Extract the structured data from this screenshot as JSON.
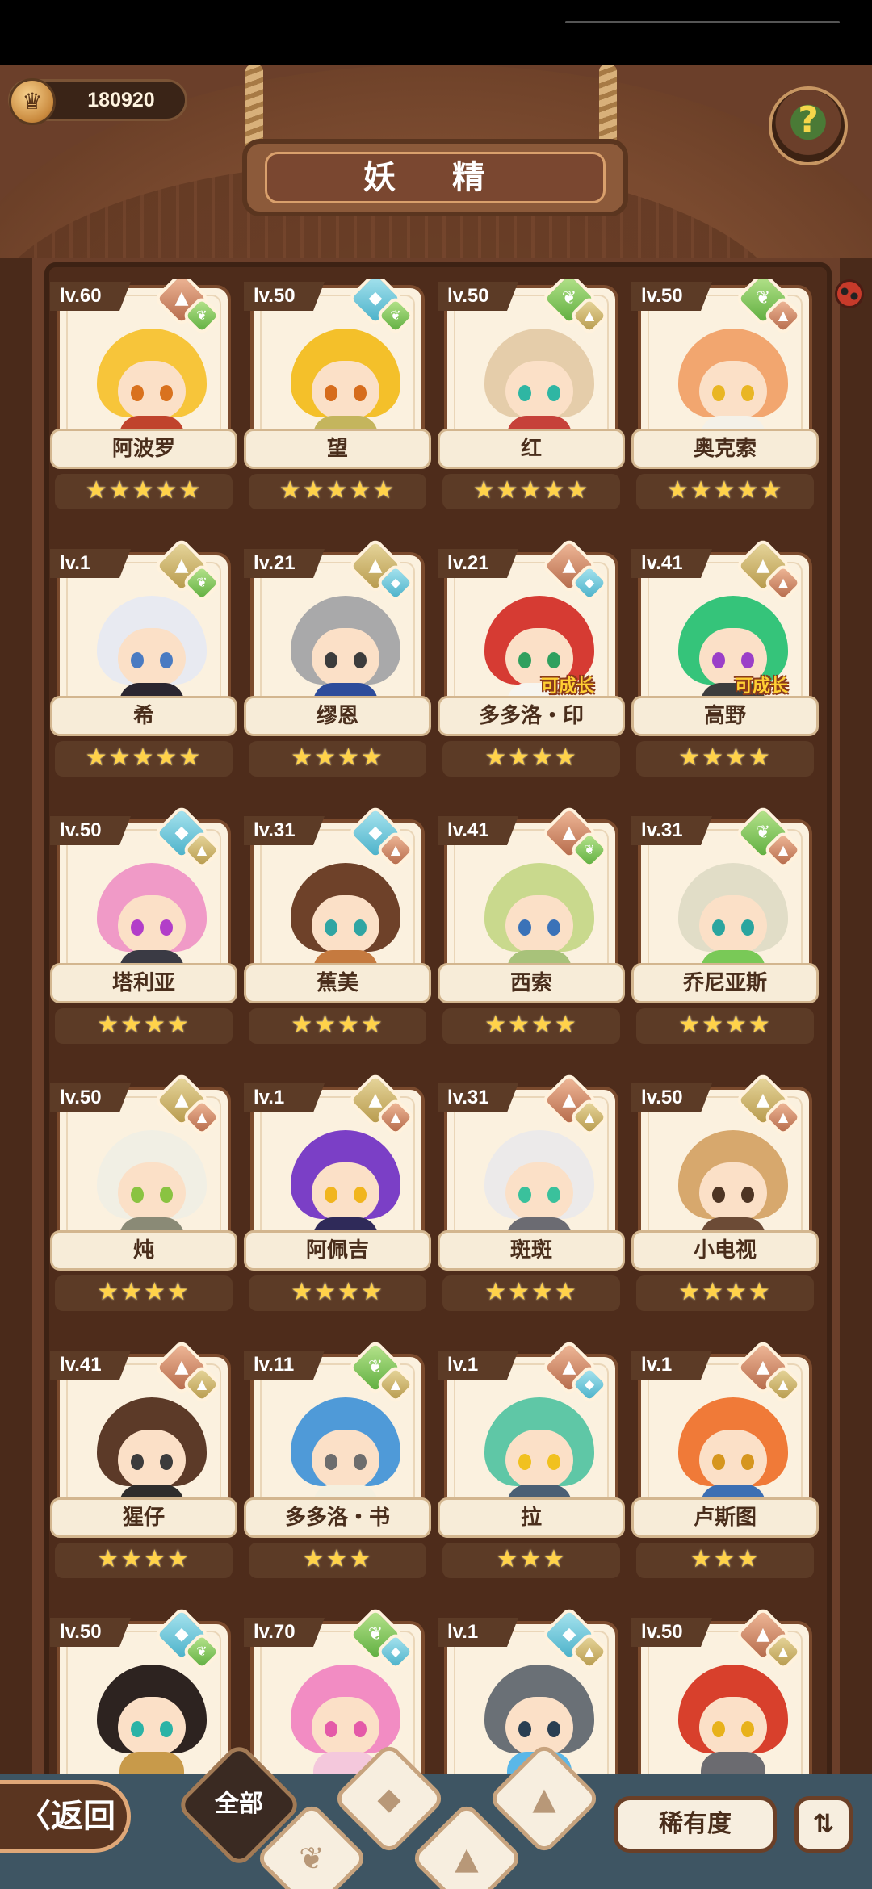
{
  "header": {
    "coin_value": "180920",
    "title": "妖 精",
    "help_icon": "question-sprout-icon"
  },
  "colors": {
    "fire": "#b56a4a",
    "water": "#4bb1c9",
    "leaf": "#5fae3f",
    "earth": "#b79a4c",
    "star": "#ffd24a"
  },
  "grid": {
    "cards": [
      {
        "level": "lv.60",
        "name": "阿波罗",
        "stars": 5,
        "elements": [
          "fire",
          "leaf"
        ],
        "hair": "#f7c53a",
        "eyes": "#d9721e",
        "body": "#c0432c",
        "grow": ""
      },
      {
        "level": "lv.50",
        "name": "望",
        "stars": 5,
        "elements": [
          "water",
          "leaf"
        ],
        "hair": "#f4c02a",
        "eyes": "#d66c1c",
        "body": "#c4b55d",
        "grow": ""
      },
      {
        "level": "lv.50",
        "name": "红",
        "stars": 5,
        "elements": [
          "leaf",
          "earth"
        ],
        "hair": "#e5cdaa",
        "eyes": "#2fb6a3",
        "body": "#c6413a",
        "grow": ""
      },
      {
        "level": "lv.50",
        "name": "奥克索",
        "stars": 5,
        "elements": [
          "leaf",
          "fire"
        ],
        "hair": "#f2a66f",
        "eyes": "#e9b624",
        "body": "#f4f1e8",
        "grow": ""
      },
      {
        "level": "lv.1",
        "name": "希",
        "stars": 5,
        "elements": [
          "earth",
          "leaf"
        ],
        "hair": "#e8eaf1",
        "eyes": "#4a7bc2",
        "body": "#2b2630",
        "grow": ""
      },
      {
        "level": "lv.21",
        "name": "缪恩",
        "stars": 4,
        "elements": [
          "earth",
          "water"
        ],
        "hair": "#a9a9aa",
        "eyes": "#3c3c3c",
        "body": "#2e4c9b",
        "grow": ""
      },
      {
        "level": "lv.21",
        "name": "多多洛・印",
        "stars": 4,
        "elements": [
          "fire",
          "water"
        ],
        "hair": "#d63b33",
        "eyes": "#2fa05e",
        "body": "#f7f5ef",
        "grow": "可成长"
      },
      {
        "level": "lv.41",
        "name": "高野",
        "stars": 4,
        "elements": [
          "earth",
          "fire"
        ],
        "hair": "#35c47a",
        "eyes": "#9b3fc8",
        "body": "#3d3d3d",
        "grow": "可成长"
      },
      {
        "level": "lv.50",
        "name": "塔利亚",
        "stars": 4,
        "elements": [
          "water",
          "earth"
        ],
        "hair": "#f09ac7",
        "eyes": "#b23ec9",
        "body": "#3a3a44",
        "grow": ""
      },
      {
        "level": "lv.31",
        "name": "蕉美",
        "stars": 4,
        "elements": [
          "water",
          "fire"
        ],
        "hair": "#6e4129",
        "eyes": "#2fa5a3",
        "body": "#c57a3f",
        "grow": ""
      },
      {
        "level": "lv.41",
        "name": "西索",
        "stars": 4,
        "elements": [
          "fire",
          "leaf"
        ],
        "hair": "#c9d98d",
        "eyes": "#3a72b8",
        "body": "#a8c27a",
        "grow": ""
      },
      {
        "level": "lv.31",
        "name": "乔尼亚斯",
        "stars": 4,
        "elements": [
          "leaf",
          "fire"
        ],
        "hair": "#e1ddc7",
        "eyes": "#2aa59f",
        "body": "#79c957",
        "grow": ""
      },
      {
        "level": "lv.50",
        "name": "炖",
        "stars": 4,
        "elements": [
          "earth",
          "fire"
        ],
        "hair": "#f1efe4",
        "eyes": "#8ac341",
        "body": "#8a8a76",
        "grow": ""
      },
      {
        "level": "lv.1",
        "name": "阿佩吉",
        "stars": 4,
        "elements": [
          "earth",
          "fire"
        ],
        "hair": "#7b3fc6",
        "eyes": "#f1b51e",
        "body": "#2f2a59",
        "grow": ""
      },
      {
        "level": "lv.31",
        "name": "斑斑",
        "stars": 4,
        "elements": [
          "fire",
          "earth"
        ],
        "hair": "#eceaea",
        "eyes": "#3ac19c",
        "body": "#6b6b72",
        "grow": ""
      },
      {
        "level": "lv.50",
        "name": "小电视",
        "stars": 4,
        "elements": [
          "earth",
          "fire"
        ],
        "hair": "#d7a86d",
        "eyes": "#4e3524",
        "body": "#6c4b36",
        "grow": ""
      },
      {
        "level": "lv.41",
        "name": "猩仔",
        "stars": 4,
        "elements": [
          "fire",
          "earth"
        ],
        "hair": "#5c3a28",
        "eyes": "#3c3c3c",
        "body": "#2f2d2c",
        "grow": ""
      },
      {
        "level": "lv.11",
        "name": "多多洛・书",
        "stars": 3,
        "elements": [
          "leaf",
          "earth"
        ],
        "hair": "#4f9ad8",
        "eyes": "#6d6d6d",
        "body": "#f5f0df",
        "grow": ""
      },
      {
        "level": "lv.1",
        "name": "拉",
        "stars": 3,
        "elements": [
          "fire",
          "water"
        ],
        "hair": "#5fc7a6",
        "eyes": "#f1c11f",
        "body": "#4b5f74",
        "grow": ""
      },
      {
        "level": "lv.1",
        "name": "卢斯图",
        "stars": 3,
        "elements": [
          "fire",
          "earth"
        ],
        "hair": "#f07a38",
        "eyes": "#d6961e",
        "body": "#3d6fb3",
        "grow": ""
      },
      {
        "level": "lv.50",
        "name": "",
        "stars": 0,
        "elements": [
          "water",
          "leaf"
        ],
        "hair": "#2d2320",
        "eyes": "#2bb3a6",
        "body": "#c89a4a",
        "grow": ""
      },
      {
        "level": "lv.70",
        "name": "",
        "stars": 0,
        "elements": [
          "leaf",
          "water"
        ],
        "hair": "#f28cc3",
        "eyes": "#e45aa8",
        "body": "#f4c8dc",
        "grow": ""
      },
      {
        "level": "lv.1",
        "name": "",
        "stars": 0,
        "elements": [
          "water",
          "earth"
        ],
        "hair": "#6a7076",
        "eyes": "#2a3f52",
        "body": "#5ab7e8",
        "grow": ""
      },
      {
        "level": "lv.50",
        "name": "",
        "stars": 0,
        "elements": [
          "fire",
          "earth"
        ],
        "hair": "#d8402c",
        "eyes": "#e8b21b",
        "body": "#6b6b70",
        "grow": ""
      }
    ]
  },
  "bottom": {
    "back_label": "〈返回",
    "filter_all_label": "全部",
    "filter_icons": [
      "sprout-icon",
      "droplet-icon",
      "mountain-icon",
      "mountain-icon"
    ],
    "sort_label": "稀有度",
    "order_icon": "sort-order-icon"
  }
}
